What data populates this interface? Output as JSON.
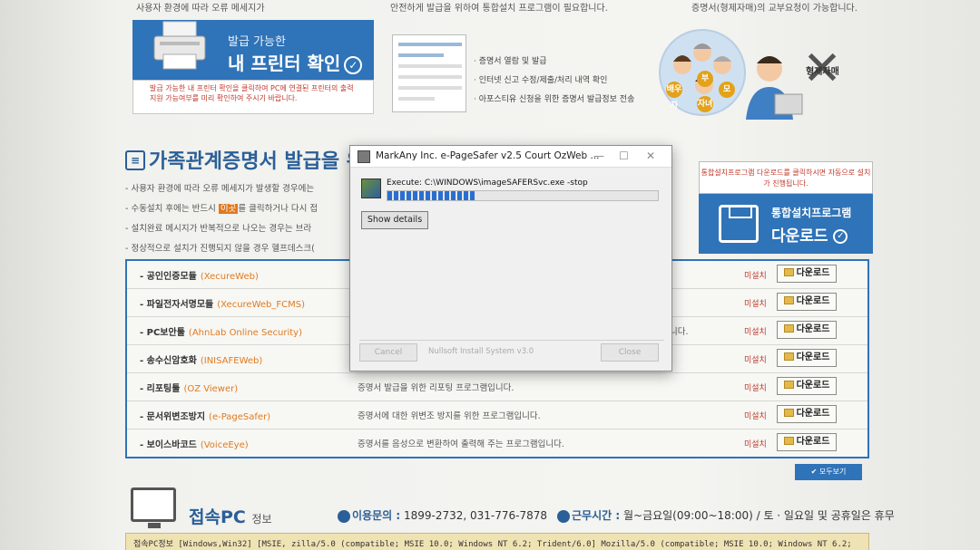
{
  "top": {
    "cut_left": "사용자 환경에 따라 오류 메세지가",
    "cut_mid": "안전하게 발급을 위하여 통합설치 프로그램이 필요합니다.",
    "cut_right": "증명서(형제자매)의 교부요청이 가능합니다.",
    "printer_sub": "발급 가능한",
    "printer_main": "내 프린터 확인",
    "printer_note": "발급 가능한 내 프린터 확인을 클릭하여 PC에 연결된 프린터의 출력지원 가능여부를 미리 확인하여 주시기 바랍니다.",
    "features": [
      "증명서 열람 및 발급",
      "인터넷 신고 수정/제출/처리 내역 확인",
      "아포스티유 신청을 위한 증명서 발급정보 전송"
    ],
    "family_labels": [
      "배우자",
      "부",
      "모",
      "자녀"
    ],
    "sibling_label": "형제자매"
  },
  "section": {
    "title": "가족관계증명서 발급을 위한",
    "notes": [
      "- 사용자 환경에 따라 오류 메세지가 발생할 경우에는",
      "- 수동설치 후에는 반드시",
      "- 설치완료 메시지가 반복적으로 나오는 경우는 브라",
      "- 정상적으로 설치가 진행되지 않을 경우 헬프데스크("
    ],
    "highlight": "이곳",
    "note2_tail": "를 클릭하거나 다시 접"
  },
  "install": {
    "hint": "통합설치프로그램 다운로드를 클릭하시면 자동으로 설치가 진행됩니다.",
    "title1": "통합설치프로그램",
    "title2": "다운로드"
  },
  "modules": [
    {
      "name": "공인인증모듈",
      "en": "(XecureWeb)",
      "desc": "",
      "status": "미설치",
      "button": "다운로드"
    },
    {
      "name": "파일전자서명모듈",
      "en": "(XecureWeb_FCMS)",
      "desc": "",
      "status": "미설치",
      "button": "다운로드"
    },
    {
      "name": "PC보안툴",
      "en": "(AhnLab Online Security)",
      "desc": "니다.",
      "status": "미설치",
      "button": "다운로드"
    },
    {
      "name": "송수신암호화",
      "en": "(INISAFEWeb)",
      "desc": "",
      "status": "미설치",
      "button": "다운로드"
    },
    {
      "name": "리포팅툴",
      "en": "(OZ Viewer)",
      "desc": "증명서 발급을 위한 리포팅 프로그램입니다.",
      "status": "미설치",
      "button": "다운로드"
    },
    {
      "name": "문서위변조방지",
      "en": "(e-PageSafer)",
      "desc": "증명서에 대한 위변조 방지를 위한 프로그램입니다.",
      "status": "미설치",
      "button": "다운로드"
    },
    {
      "name": "보이스바코드",
      "en": "(VoiceEye)",
      "desc": "증명서를 음성으로 변환하여 출력해 주는 프로그램입니다.",
      "status": "미설치",
      "button": "다운로드"
    }
  ],
  "view_all": "모두보기",
  "bottom": {
    "pc_title": "접속PC",
    "pc_sub": "정보",
    "contact_label": "이용문의 :",
    "contact_value": "1899-2732, 031-776-7878",
    "hours_label": "근무시간 :",
    "hours_value": "월~금요일(09:00~18:00) / 토 · 일요일 및 공휴일은 휴무",
    "pcinfo": "접속PC정보 [Windows,Win32] [MSIE, zilla/5.0 (compatible; MSIE 10.0; Windows NT 6.2; Trident/6.0] Mozilla/5.0 (compatible; MSIE 10.0; Windows NT 6.2;"
  },
  "dialog": {
    "title": "MarkAny Inc. e-PageSafer v2.5 Court OzWeb ...",
    "execute": "Execute: C:\\WINDOWS\\imageSAFERSvc.exe -stop",
    "progress": 0.33,
    "show_details": "Show details",
    "cancel": "Cancel",
    "nsis": "Nullsoft Install System v3.0",
    "close": "Close"
  }
}
